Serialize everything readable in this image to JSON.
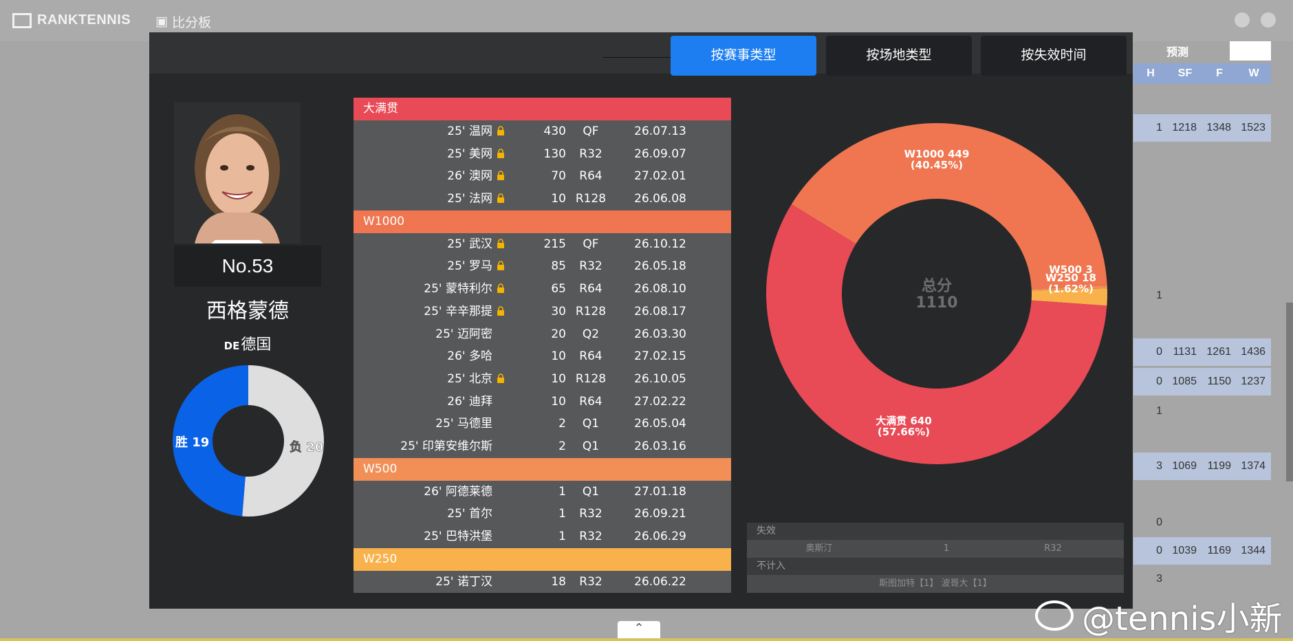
{
  "app": {
    "logo_text": "RANKTENNIS",
    "nav_tab": "比分板",
    "bg_header": "预测",
    "bg_columns": [
      "H",
      "SF",
      "F",
      "W"
    ],
    "bg_rows": [
      {
        "vals": [
          "1",
          "1218",
          "1348",
          "1523"
        ],
        "hl": true
      },
      {
        "vals": [
          "1",
          "",
          "",
          ""
        ],
        "hl": false
      },
      {
        "vals": [
          "0",
          "1131",
          "1261",
          "1436"
        ],
        "hl": true
      },
      {
        "vals": [
          "0",
          "1085",
          "1150",
          "1237"
        ],
        "hl": true
      },
      {
        "vals": [
          "1",
          "",
          "",
          ""
        ],
        "hl": false
      },
      {
        "vals": [
          "3",
          "1069",
          "1199",
          "1374"
        ],
        "hl": true
      },
      {
        "vals": [
          "0",
          "",
          "",
          ""
        ],
        "hl": false
      },
      {
        "vals": [
          "0",
          "1039",
          "1169",
          "1344"
        ],
        "hl": true
      },
      {
        "vals": [
          "3",
          "",
          "",
          ""
        ],
        "hl": false
      }
    ]
  },
  "tabs": [
    {
      "label": "按赛事类型",
      "active": true
    },
    {
      "label": "按场地类型",
      "active": false
    },
    {
      "label": "按失效时间",
      "active": false
    }
  ],
  "player": {
    "rank": "No.53",
    "name": "西格蒙德",
    "country_code": "DE",
    "country": "德国",
    "wins_label": "胜 19",
    "losses_label": "负 20",
    "wins": 19,
    "losses": 20,
    "win_color": "#0a63e6",
    "loss_color": "#dedede"
  },
  "categories": [
    {
      "name": "大满贯",
      "color": "#e84a56",
      "rows": [
        {
          "event": "25' 温网",
          "locked": true,
          "points": "430",
          "round": "QF",
          "date": "26.07.13"
        },
        {
          "event": "25' 美网",
          "locked": true,
          "points": "130",
          "round": "R32",
          "date": "26.09.07"
        },
        {
          "event": "26' 澳网",
          "locked": true,
          "points": "70",
          "round": "R64",
          "date": "27.02.01"
        },
        {
          "event": "25' 法网",
          "locked": true,
          "points": "10",
          "round": "R128",
          "date": "26.06.08"
        }
      ]
    },
    {
      "name": "W1000",
      "color": "#ef7651",
      "rows": [
        {
          "event": "25' 武汉",
          "locked": true,
          "points": "215",
          "round": "QF",
          "date": "26.10.12"
        },
        {
          "event": "25' 罗马",
          "locked": true,
          "points": "85",
          "round": "R32",
          "date": "26.05.18"
        },
        {
          "event": "25' 蒙特利尔",
          "locked": true,
          "points": "65",
          "round": "R64",
          "date": "26.08.10"
        },
        {
          "event": "25' 辛辛那提",
          "locked": true,
          "points": "30",
          "round": "R128",
          "date": "26.08.17"
        },
        {
          "event": "25' 迈阿密",
          "locked": false,
          "points": "20",
          "round": "Q2",
          "date": "26.03.30"
        },
        {
          "event": "26' 多哈",
          "locked": false,
          "points": "10",
          "round": "R64",
          "date": "27.02.15"
        },
        {
          "event": "25' 北京",
          "locked": true,
          "points": "10",
          "round": "R128",
          "date": "26.10.05"
        },
        {
          "event": "26' 迪拜",
          "locked": false,
          "points": "10",
          "round": "R64",
          "date": "27.02.22"
        },
        {
          "event": "25' 马德里",
          "locked": false,
          "points": "2",
          "round": "Q1",
          "date": "26.05.04"
        },
        {
          "event": "25' 印第安维尔斯",
          "locked": false,
          "points": "2",
          "round": "Q1",
          "date": "26.03.16"
        }
      ]
    },
    {
      "name": "W500",
      "color": "#f28f57",
      "rows": [
        {
          "event": "26' 阿德莱德",
          "locked": false,
          "points": "1",
          "round": "Q1",
          "date": "27.01.18"
        },
        {
          "event": "25' 首尔",
          "locked": false,
          "points": "1",
          "round": "R32",
          "date": "26.09.21"
        },
        {
          "event": "25' 巴特洪堡",
          "locked": false,
          "points": "1",
          "round": "R32",
          "date": "26.06.29"
        }
      ]
    },
    {
      "name": "W250",
      "color": "#f9b24b",
      "rows": [
        {
          "event": "25' 诺丁汉",
          "locked": false,
          "points": "18",
          "round": "R32",
          "date": "26.06.22"
        }
      ]
    }
  ],
  "chart_data": {
    "type": "pie",
    "center_title": "总分",
    "center_value": "1110",
    "slices": [
      {
        "label": "W1000",
        "value": 449,
        "pct": "40.45%",
        "color": "#ef7651"
      },
      {
        "label": "W500",
        "value": 3,
        "pct": "",
        "color": "#f28f57"
      },
      {
        "label": "W250",
        "value": 18,
        "pct": "1.62%",
        "color": "#f9b24b"
      },
      {
        "label": "大满贯",
        "value": 640,
        "pct": "57.66%",
        "color": "#e84a56"
      }
    ]
  },
  "expired": {
    "header": "失效",
    "rows": [
      {
        "event": "奥斯汀",
        "points": "1",
        "round": "R32"
      }
    ],
    "excluded_header": "不计入",
    "excluded_text": "斯图加特【1】 波哥大【1】"
  },
  "watermark": "@tennis小新"
}
